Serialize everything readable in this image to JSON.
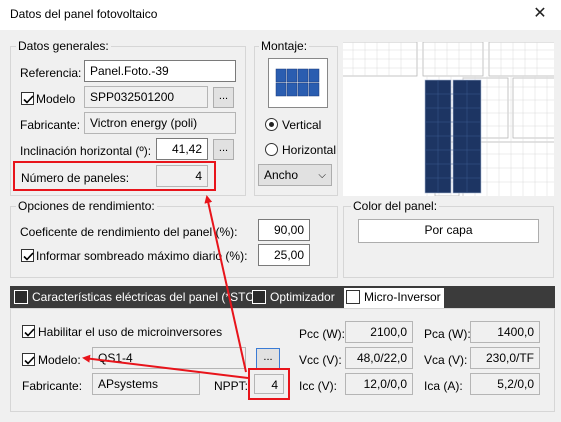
{
  "window": {
    "title": "Datos del panel fotovoltaico",
    "close_icon": "close-icon"
  },
  "general": {
    "legend": "Datos generales:",
    "referencia_label": "Referencia:",
    "referencia_value": "Panel.Foto.-39",
    "modelo_label": "Modelo",
    "modelo_checked": true,
    "modelo_value": "SPP032501200",
    "modelo_btn": "...",
    "fabricante_label": "Fabricante:",
    "fabricante_value": "Victron energy (poli)",
    "inclinacion_label": "Inclinación horizontal (º):",
    "inclinacion_value": "41,42",
    "inclinacion_btn": "...",
    "num_paneles_label": "Número de paneles:",
    "num_paneles_value": "4"
  },
  "montaje": {
    "legend": "Montaje:",
    "vertical_label": "Vertical",
    "horizontal_label": "Horizontal",
    "selected": "Vertical",
    "combo_value": "Ancho"
  },
  "rendimiento": {
    "legend": "Opciones de rendimiento:",
    "coef_label": "Coeficente de rendimiento del panel (%):",
    "coef_value": "90,00",
    "sombreado_label": "Informar sombreado máximo diario (%):",
    "sombreado_checked": true,
    "sombreado_value": "25,00"
  },
  "color": {
    "legend": "Color del panel:",
    "button": "Por capa"
  },
  "tabs": [
    {
      "label": "Características eléctricas del panel (*STC)",
      "icon": "table-icon",
      "active": false
    },
    {
      "label": "Optimizador",
      "icon": "optimizer-icon",
      "active": false
    },
    {
      "label": "Micro-Inversor",
      "icon": "inverter-icon",
      "active": true
    }
  ],
  "micro": {
    "habilitar_label": "Habilitar el uso de microinversores",
    "habilitar_checked": true,
    "modelo_label": "Modelo:",
    "modelo_checked": true,
    "modelo_value": "QS1-4",
    "modelo_btn": "...",
    "fabricante_label": "Fabricante:",
    "fabricante_value": "APsystems",
    "nppt_label": "NPPT:",
    "nppt_value": "4",
    "pcc_label": "Pcc (W):",
    "pcc_value": "2100,0",
    "vcc_label": "Vcc (V):",
    "vcc_value": "48,0/22,0",
    "icc_label": "Icc (V):",
    "icc_value": "12,0/0,0",
    "pca_label": "Pca (W):",
    "pca_value": "1400,0",
    "vca_label": "Vca (V):",
    "vca_value": "230,0/TF",
    "ica_label": "Ica (A):",
    "ica_value": "5,2/0,0"
  },
  "colors": {
    "highlight": "#e8141b",
    "panel_blue": "#1d3563",
    "tab_bar": "#3b3b3b"
  }
}
